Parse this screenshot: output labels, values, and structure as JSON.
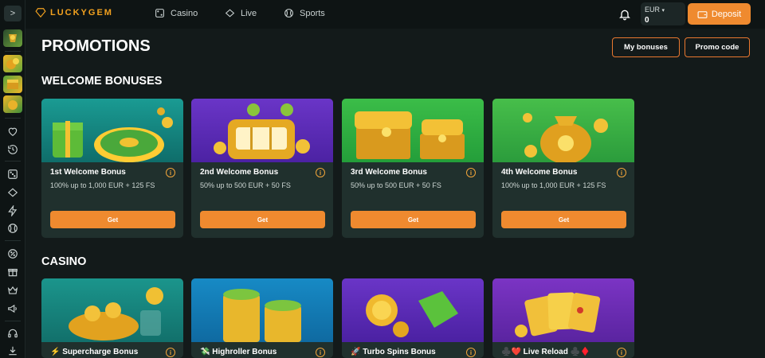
{
  "brand": {
    "logo_text": "LUCKYGEM",
    "accent": "#ef8a2f"
  },
  "nav": [
    {
      "label": "Casino",
      "icon": "dice-icon"
    },
    {
      "label": "Live",
      "icon": "diamond-icon"
    },
    {
      "label": "Sports",
      "icon": "ball-icon"
    }
  ],
  "account": {
    "currency": "EUR",
    "balance": "0",
    "deposit_label": "Deposit"
  },
  "sidebar": {
    "toggle": ">",
    "icons": [
      "heart-icon",
      "history-icon",
      "dice-icon",
      "diamond-icon",
      "lightning-icon",
      "ball-icon",
      "percent-icon",
      "gift-icon",
      "crown-icon",
      "megaphone-icon",
      "headset-icon",
      "download-icon"
    ]
  },
  "page": {
    "title": "PROMOTIONS",
    "my_bonuses_label": "My bonuses",
    "promo_code_label": "Promo code"
  },
  "welcome": {
    "title": "WELCOME BONUSES",
    "cards": [
      {
        "title": "1st Welcome Bonus",
        "subtitle": "100% up to 1,000 EUR + 125 FS",
        "button": "Get"
      },
      {
        "title": "2nd Welcome Bonus",
        "subtitle": "50% up to 500 EUR + 50 FS",
        "button": "Get"
      },
      {
        "title": "3rd Welcome Bonus",
        "subtitle": "50% up to 500 EUR + 50 FS",
        "button": "Get"
      },
      {
        "title": "4th Welcome Bonus",
        "subtitle": "100% up to 1,000 EUR + 125 FS",
        "button": "Get"
      }
    ]
  },
  "casino": {
    "title": "CASINO",
    "cards": [
      {
        "title": "⚡ Supercharge Bonus"
      },
      {
        "title": "💸 Highroller Bonus"
      },
      {
        "title": "🚀 Turbo Spins Bonus"
      },
      {
        "title": "♣️❤️ Live Reload ♣️♦️"
      }
    ]
  }
}
